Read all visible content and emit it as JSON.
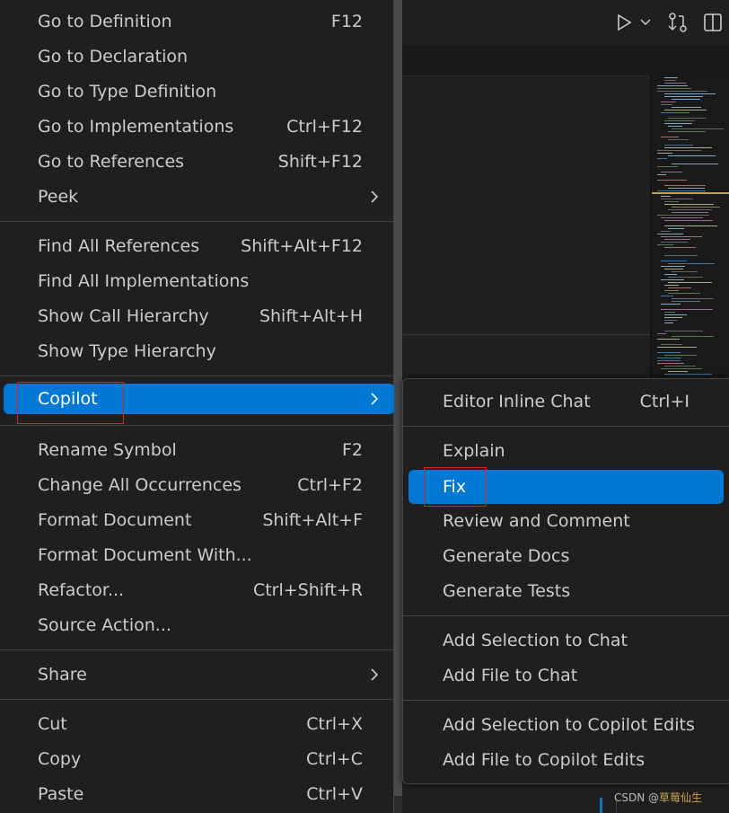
{
  "context_menu": {
    "items": [
      {
        "label": "Go to Definition",
        "shortcut": "F12"
      },
      {
        "label": "Go to Declaration",
        "shortcut": ""
      },
      {
        "label": "Go to Type Definition",
        "shortcut": ""
      },
      {
        "label": "Go to Implementations",
        "shortcut": "Ctrl+F12"
      },
      {
        "label": "Go to References",
        "shortcut": "Shift+F12"
      },
      {
        "label": "Peek",
        "shortcut": ""
      },
      {
        "label": "Find All References",
        "shortcut": "Shift+Alt+F12"
      },
      {
        "label": "Find All Implementations",
        "shortcut": ""
      },
      {
        "label": "Show Call Hierarchy",
        "shortcut": "Shift+Alt+H"
      },
      {
        "label": "Show Type Hierarchy",
        "shortcut": ""
      },
      {
        "label": "Copilot",
        "shortcut": ""
      },
      {
        "label": "Rename Symbol",
        "shortcut": "F2"
      },
      {
        "label": "Change All Occurrences",
        "shortcut": "Ctrl+F2"
      },
      {
        "label": "Format Document",
        "shortcut": "Shift+Alt+F"
      },
      {
        "label": "Format Document With...",
        "shortcut": ""
      },
      {
        "label": "Refactor...",
        "shortcut": "Ctrl+Shift+R"
      },
      {
        "label": "Source Action...",
        "shortcut": ""
      },
      {
        "label": "Share",
        "shortcut": ""
      },
      {
        "label": "Cut",
        "shortcut": "Ctrl+X"
      },
      {
        "label": "Copy",
        "shortcut": "Ctrl+C"
      },
      {
        "label": "Paste",
        "shortcut": "Ctrl+V"
      }
    ]
  },
  "copilot_submenu": {
    "items": [
      {
        "label": "Editor Inline Chat",
        "shortcut": "Ctrl+I"
      },
      {
        "label": "Explain",
        "shortcut": ""
      },
      {
        "label": "Fix",
        "shortcut": ""
      },
      {
        "label": "Review and Comment",
        "shortcut": ""
      },
      {
        "label": "Generate Docs",
        "shortcut": ""
      },
      {
        "label": "Generate Tests",
        "shortcut": ""
      },
      {
        "label": "Add Selection to Chat",
        "shortcut": ""
      },
      {
        "label": "Add File to Chat",
        "shortcut": ""
      },
      {
        "label": "Add Selection to Copilot Edits",
        "shortcut": ""
      },
      {
        "label": "Add File to Copilot Edits",
        "shortcut": ""
      }
    ]
  },
  "watermark": {
    "prefix": "CSDN @",
    "name": "草莓仙生"
  },
  "colors": {
    "accent": "#0078d4",
    "highlight_box": "#e02020",
    "menu_bg": "#1f1f1f"
  },
  "icons": [
    "run-icon",
    "chevron-down-icon",
    "source-control-icon",
    "split-editor-icon",
    "chevron-right-icon"
  ]
}
